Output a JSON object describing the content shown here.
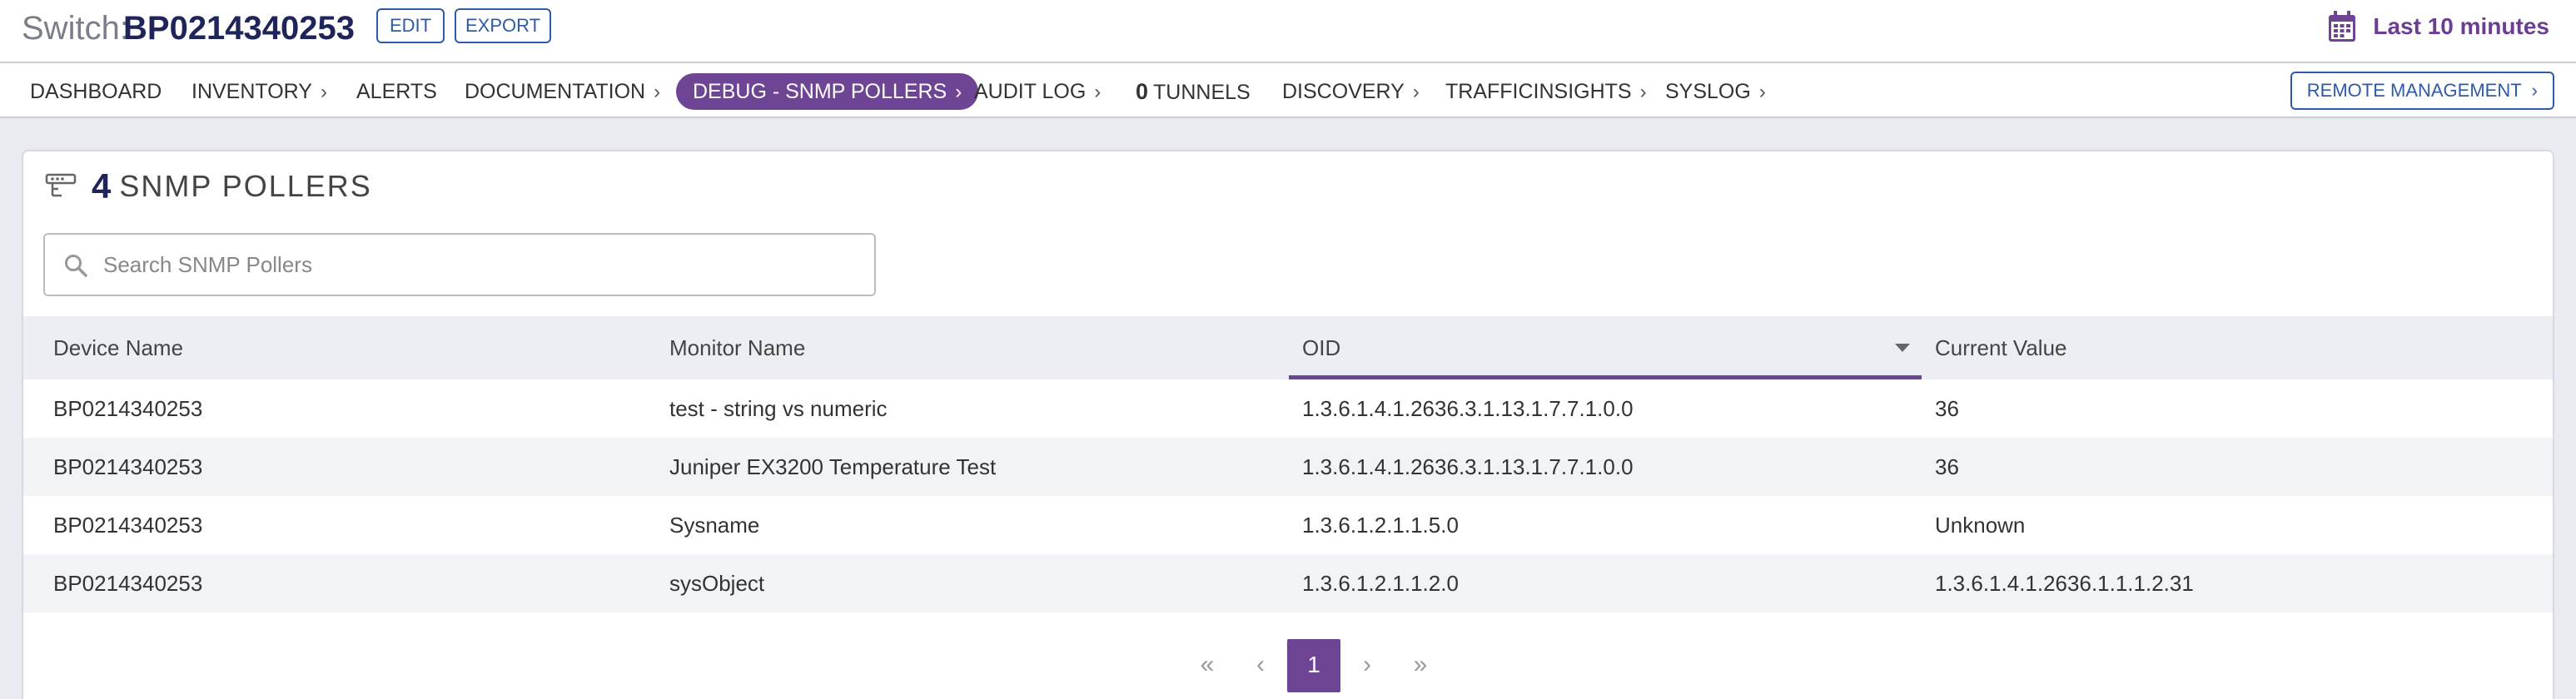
{
  "header": {
    "prefix": "Switch:",
    "device_name": "BP0214340253",
    "edit_label": "EDIT",
    "export_label": "EXPORT",
    "time_range": "Last 10 minutes",
    "accent_color": "#6d4594"
  },
  "nav": {
    "items": [
      {
        "label": "DASHBOARD",
        "chevron": ""
      },
      {
        "label": "INVENTORY",
        "chevron": "›"
      },
      {
        "label": "ALERTS",
        "chevron": ""
      },
      {
        "label": "DOCUMENTATION",
        "chevron": "›"
      },
      {
        "label": "DEBUG - SNMP POLLERS",
        "chevron": "›"
      },
      {
        "label": "AUDIT LOG",
        "chevron": "›"
      },
      {
        "count": "0",
        "label": "TUNNELS",
        "chevron": ""
      },
      {
        "label": "DISCOVERY",
        "chevron": "›"
      },
      {
        "label": "TRAFFICINSIGHTS",
        "chevron": "›"
      },
      {
        "label": "SYSLOG",
        "chevron": "›"
      }
    ],
    "remote_label": "REMOTE MANAGEMENT"
  },
  "panel": {
    "count": "4",
    "title": "SNMP POLLERS",
    "search_placeholder": "Search SNMP Pollers"
  },
  "table": {
    "columns": [
      "Device Name",
      "Monitor Name",
      "OID",
      "Current Value"
    ],
    "rows": [
      [
        "BP0214340253",
        "test - string vs numeric",
        "1.3.6.1.4.1.2636.3.1.13.1.7.7.1.0.0",
        "36"
      ],
      [
        "BP0214340253",
        "Juniper EX3200 Temperature Test",
        "1.3.6.1.4.1.2636.3.1.13.1.7.7.1.0.0",
        "36"
      ],
      [
        "BP0214340253",
        "Sysname",
        "1.3.6.1.2.1.1.5.0",
        "Unknown"
      ],
      [
        "BP0214340253",
        "sysObject",
        "1.3.6.1.2.1.1.2.0",
        "1.3.6.1.4.1.2636.1.1.1.2.31"
      ]
    ]
  },
  "pagination": {
    "first": "«",
    "prev": "‹",
    "current_page": "1",
    "next": "›",
    "last": "»"
  }
}
